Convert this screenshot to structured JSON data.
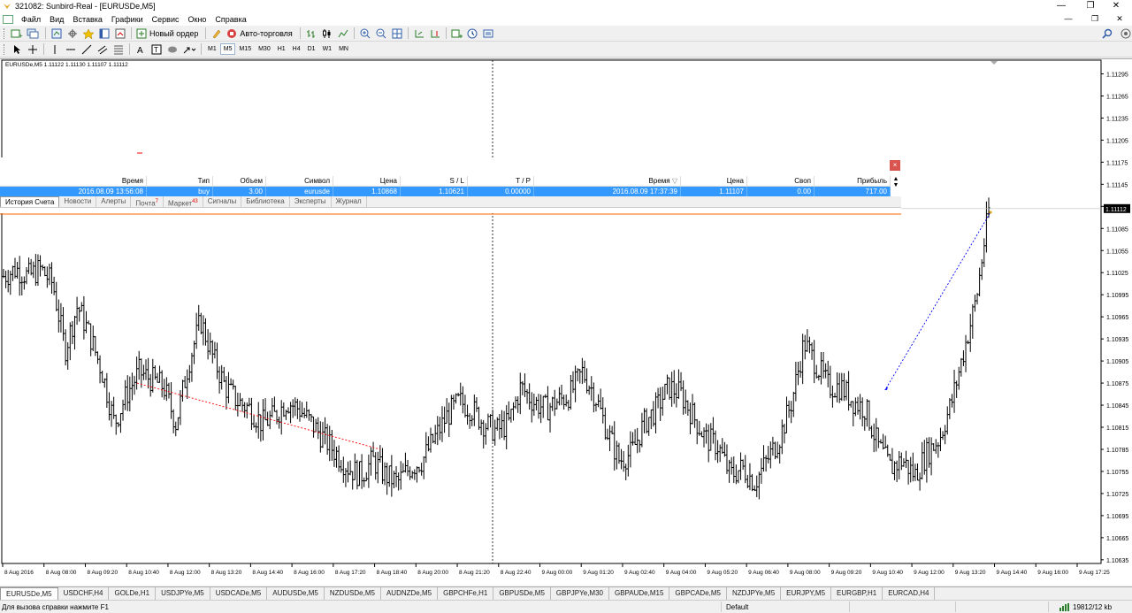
{
  "window": {
    "title": "321082: Sunbird-Real - [EURUSDe,M5]",
    "controls": [
      "—",
      "❐",
      "✕"
    ]
  },
  "menu": {
    "items": [
      "Файл",
      "Вид",
      "Вставка",
      "Графики",
      "Сервис",
      "Окно",
      "Справка"
    ],
    "right_controls": [
      "—",
      "❐",
      "✕"
    ]
  },
  "toolbar": {
    "new_order_label": "Новый ордер",
    "autotrading_label": "Авто-торговля",
    "timeframes": [
      "M1",
      "M5",
      "M15",
      "M30",
      "H1",
      "H4",
      "D1",
      "W1",
      "MN"
    ],
    "active_timeframe": "M5"
  },
  "chart": {
    "symbol_info": "EURUSDe,M5  1.11122 1.11130 1.11107 1.11112",
    "current_price": "1.11112",
    "price_ticks": [
      "1.11295",
      "1.11265",
      "1.11235",
      "1.11205",
      "1.11175",
      "1.11145",
      "1.11115",
      "1.11085",
      "1.11055",
      "1.11025",
      "1.10995",
      "1.10965",
      "1.10935",
      "1.10905",
      "1.10875",
      "1.10845",
      "1.10815",
      "1.10785",
      "1.10755",
      "1.10725",
      "1.10695",
      "1.10665",
      "1.10635"
    ],
    "time_ticks": [
      "8 Aug 2016",
      "8 Aug 08:00",
      "8 Aug 09:20",
      "8 Aug 10:40",
      "8 Aug 12:00",
      "8 Aug 13:20",
      "8 Aug 14:40",
      "8 Aug 16:00",
      "8 Aug 17:20",
      "8 Aug 18:40",
      "8 Aug 20:00",
      "8 Aug 21:20",
      "8 Aug 22:40",
      "9 Aug 00:00",
      "9 Aug 01:20",
      "9 Aug 02:40",
      "9 Aug 04:00",
      "9 Aug 05:20",
      "9 Aug 06:40",
      "9 Aug 08:00",
      "9 Aug 09:20",
      "9 Aug 10:40",
      "9 Aug 12:00",
      "9 Aug 13:20",
      "9 Aug 14:40",
      "9 Aug 16:00",
      "9 Aug 17:25"
    ],
    "colors": {
      "bars": "#000000",
      "grid_separator": "#000000",
      "price_line": "#c0c0c0",
      "trade_line_buy": "#0000ff",
      "trade_line_hist": "#ff0000",
      "current_price_bg": "#000000",
      "stop_line": "#ff6600"
    }
  },
  "chart_data": {
    "type": "bar",
    "title": "",
    "x_range": [
      "8 Aug 2016",
      "9 Aug 17:25"
    ],
    "ylim": [
      1.1063,
      1.1131
    ],
    "close_trace": [
      1.1102,
      1.1103,
      1.1102,
      1.1103,
      1.1101,
      1.1092,
      1.1098,
      1.1094,
      1.1089,
      1.1082,
      1.1086,
      1.1089,
      1.1088,
      1.1087,
      1.1082,
      1.109,
      1.1096,
      1.1091,
      1.1087,
      1.1085,
      1.1084,
      1.1082,
      1.1083,
      1.1085,
      1.1084,
      1.1082,
      1.108,
      1.1078,
      1.1076,
      1.1075,
      1.1077,
      1.1075,
      1.1074,
      1.1076,
      1.1077,
      1.108,
      1.1083,
      1.1085,
      1.1084,
      1.1082,
      1.1081,
      1.1082,
      1.1087,
      1.1085,
      1.1084,
      1.1085,
      1.1086,
      1.1089,
      1.1086,
      1.1081,
      1.1077,
      1.1078,
      1.1082,
      1.1084,
      1.1087,
      1.1086,
      1.1083,
      1.108,
      1.1079,
      1.1075,
      1.1076,
      1.1074,
      1.1077,
      1.108,
      1.1085,
      1.1093,
      1.109,
      1.1087,
      1.1087,
      1.1085,
      1.1084,
      1.1079,
      1.1076,
      1.1077,
      1.1075,
      1.1078,
      1.108,
      1.1085,
      1.1092,
      1.1099,
      1.1111
    ],
    "trades": [
      {
        "side": "buy",
        "volume": "3.00",
        "symbol": "eurusde",
        "open_time": "2016.08.09 13:56:08",
        "open_price": "1.10868",
        "sl": "1.10621",
        "tp": "0.00000",
        "close_time": "2016.08.09 17:37:39",
        "close_price": "1.11107",
        "swap": "0.00",
        "profit": "717.00"
      }
    ]
  },
  "terminal": {
    "close_label": "×",
    "columns": [
      "Время",
      "Тип",
      "Объем",
      "Символ",
      "Цена",
      "S / L",
      "T / P",
      "Время",
      "Цена",
      "Своп",
      "Прибыль"
    ],
    "sort_marker": "▽",
    "row": [
      "2016.08.09 13:56:08",
      "buy",
      "3.00",
      "eurusde",
      "1.10868",
      "1.10621",
      "0.00000",
      "2016.08.09 17:37:39",
      "1.11107",
      "0.00",
      "717.00"
    ],
    "scroll_up": "▲",
    "scroll_down": "▼",
    "tabs": [
      {
        "label": "История Счета",
        "badge": ""
      },
      {
        "label": "Новости",
        "badge": ""
      },
      {
        "label": "Алерты",
        "badge": ""
      },
      {
        "label": "Почта",
        "badge": "7"
      },
      {
        "label": "Маркет",
        "badge": "43"
      },
      {
        "label": "Сигналы",
        "badge": ""
      },
      {
        "label": "Библиотека",
        "badge": ""
      },
      {
        "label": "Эксперты",
        "badge": ""
      },
      {
        "label": "Журнал",
        "badge": ""
      }
    ]
  },
  "chart_tabs": [
    "EURUSDe,M5",
    "USDCHF,H4",
    "GOLDe,H1",
    "USDJPYe,M5",
    "USDCADe,M5",
    "AUDUSDe,M5",
    "NZDUSDe,M5",
    "AUDNZDe,M5",
    "GBPCHFe,H1",
    "GBPUSDe,M5",
    "GBPJPYe,M30",
    "GBPAUDe,M15",
    "GBPCADe,M5",
    "NZDJPYe,M5",
    "EURJPY,M5",
    "EURGBP,H1",
    "EURCAD,H4"
  ],
  "status": {
    "hint": "Для вызова справки нажмите F1",
    "profile": "Default",
    "connection": "19812/12 kb"
  }
}
